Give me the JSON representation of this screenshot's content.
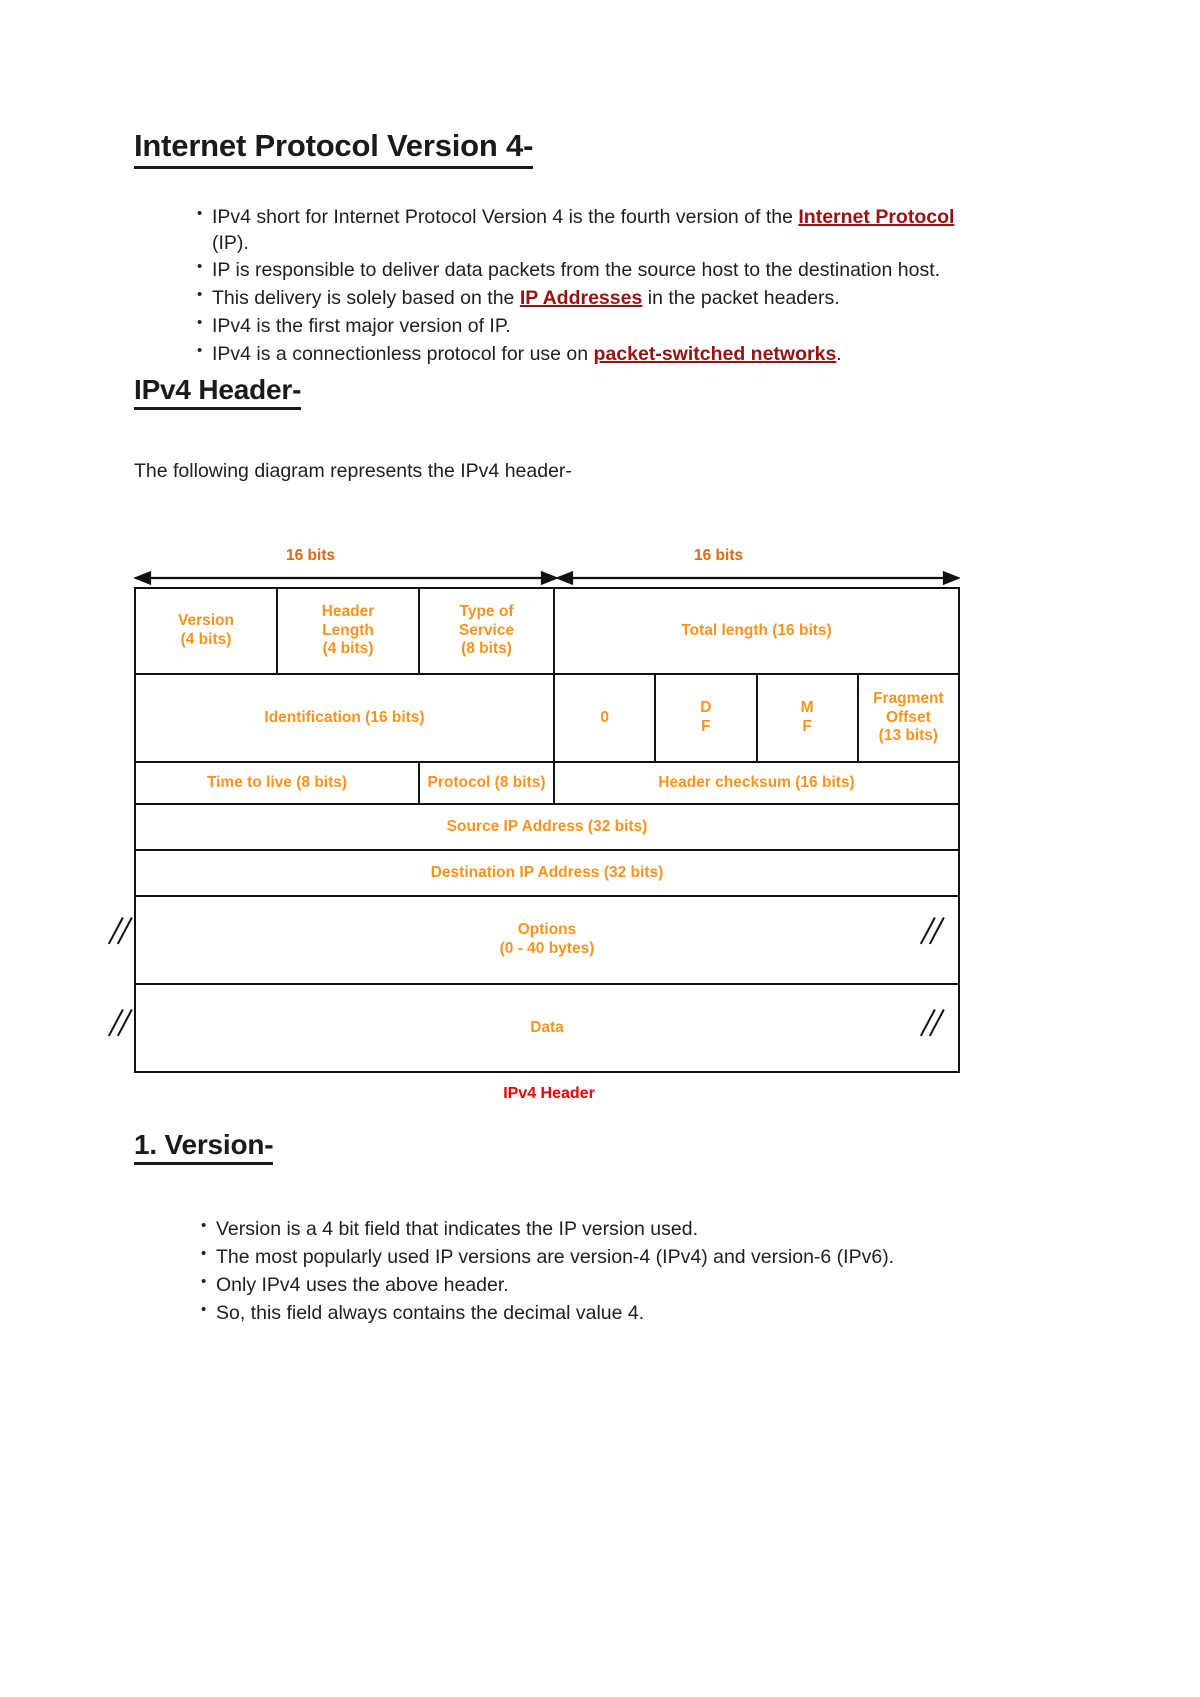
{
  "document": {
    "title": "Internet Protocol Version 4-",
    "intro_bullets": [
      {
        "parts": [
          {
            "t": "IPv4 short for Internet Protocol Version 4 is the fourth version of the ",
            "style": "plain"
          },
          {
            "t": "Internet Protocol",
            "style": "highlight"
          },
          {
            "t": " (IP).",
            "style": "plain"
          }
        ]
      },
      {
        "parts": [
          {
            "t": "IP is responsible to deliver data packets from the source host to the destination host.",
            "style": "plain"
          }
        ]
      },
      {
        "parts": [
          {
            "t": "This delivery is solely based on the ",
            "style": "plain"
          },
          {
            "t": "IP Addresses",
            "style": "highlight"
          },
          {
            "t": " in the packet headers.",
            "style": "plain"
          }
        ]
      },
      {
        "parts": [
          {
            "t": "IPv4 is the first major version of IP.",
            "style": "plain"
          }
        ]
      },
      {
        "parts": [
          {
            "t": "IPv4 is a connectionless protocol for use on ",
            "style": "plain"
          },
          {
            "t": "packet-switched networks",
            "style": "highlight"
          },
          {
            "t": ".",
            "style": "plain"
          }
        ]
      }
    ],
    "header_section": {
      "heading": "IPv4 Header-",
      "lead": "The following diagram represents the IPv4 header-"
    },
    "version_section": {
      "heading": "1. Version-",
      "bullets": [
        "Version is a 4 bit field that indicates the IP version used.",
        "The most popularly used IP versions are version-4 (IPv4) and version-6 (IPv6).",
        "Only IPv4 uses the above header.",
        "So, this field always contains the decimal value 4."
      ]
    }
  },
  "diagram": {
    "bits_label_left": "16 bits",
    "bits_label_right": "16 bits",
    "caption": "IPv4 Header",
    "accent_color": "#f7931e",
    "caption_color": "#ee0000",
    "rows": [
      {
        "cells": [
          {
            "label": "Version\n(4 bits)",
            "line1": "Version",
            "line2": "(4 bits)"
          },
          {
            "label": "Header Length (4 bits)",
            "line1": "Header",
            "line2": "Length",
            "line3": "(4 bits)"
          },
          {
            "label": "Type of Service (8 bits)",
            "line1": "Type of",
            "line2": "Service",
            "line3": "(8 bits)"
          },
          {
            "label": "Total length (16 bits)",
            "line1": "Total length (16 bits)"
          }
        ]
      },
      {
        "cells": [
          {
            "label": "Identification (16 bits)",
            "line1": "Identification (16 bits)"
          },
          {
            "label": "0",
            "line1": "0"
          },
          {
            "label": "DF",
            "line1": "D",
            "line2": "F"
          },
          {
            "label": "MF",
            "line1": "M",
            "line2": "F"
          },
          {
            "label": "Fragment Offset (13 bits)",
            "line1": "Fragment Offset",
            "line2": "(13 bits)"
          }
        ]
      },
      {
        "cells": [
          {
            "label": "Time to live (8 bits)",
            "line1": "Time to live (8 bits)"
          },
          {
            "label": "Protocol (8 bits)",
            "line1": "Protocol (8 bits)"
          },
          {
            "label": "Header checksum (16 bits)",
            "line1": "Header checksum (16 bits)"
          }
        ]
      },
      {
        "cells": [
          {
            "label": "Source IP Address (32 bits)",
            "line1": "Source IP Address (32 bits)"
          }
        ]
      },
      {
        "cells": [
          {
            "label": "Destination IP Address (32 bits)",
            "line1": "Destination IP Address (32 bits)"
          }
        ]
      },
      {
        "cells": [
          {
            "label": "Options (0 - 40 bytes)",
            "line1": "Options",
            "line2": "(0 - 40 bytes)"
          }
        ]
      },
      {
        "cells": [
          {
            "label": "Data",
            "line1": "Data"
          }
        ]
      }
    ]
  }
}
